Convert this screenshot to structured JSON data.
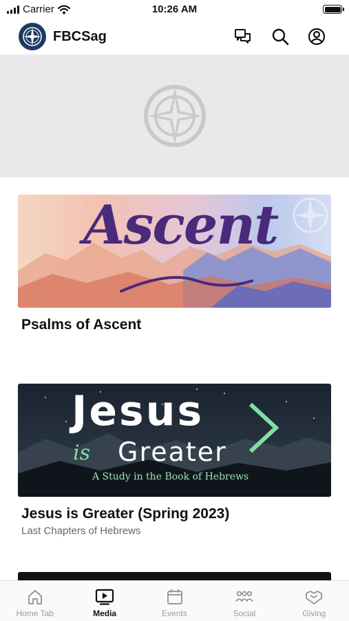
{
  "status_bar": {
    "carrier": "Carrier",
    "time": "10:26 AM"
  },
  "header": {
    "title": "FBCSag",
    "icons": [
      "chat-icon",
      "search-icon",
      "account-icon"
    ]
  },
  "cards": [
    {
      "title": "Psalms of Ascent",
      "subtitle": "",
      "image_text": {
        "word": "Ascent"
      }
    },
    {
      "title": "Jesus is Greater (Spring 2023)",
      "subtitle": "Last Chapters of Hebrews",
      "image_text": {
        "line1": "Jesus",
        "is": "is",
        "line2": "Greater",
        "caption": "A Study in the Book of Hebrews"
      }
    }
  ],
  "tabs": [
    {
      "label": "Home Tab",
      "icon": "home-icon",
      "active": false
    },
    {
      "label": "Media",
      "icon": "media-icon",
      "active": true
    },
    {
      "label": "Events",
      "icon": "calendar-icon",
      "active": false
    },
    {
      "label": "Social",
      "icon": "social-icon",
      "active": false
    },
    {
      "label": "Giving",
      "icon": "giving-icon",
      "active": false
    }
  ],
  "colors": {
    "logo_bg": "#1d3a63",
    "hero_bg": "#e9e9eb",
    "accent_green": "#7de0a4",
    "ascent_purple": "#4a2a7a"
  }
}
